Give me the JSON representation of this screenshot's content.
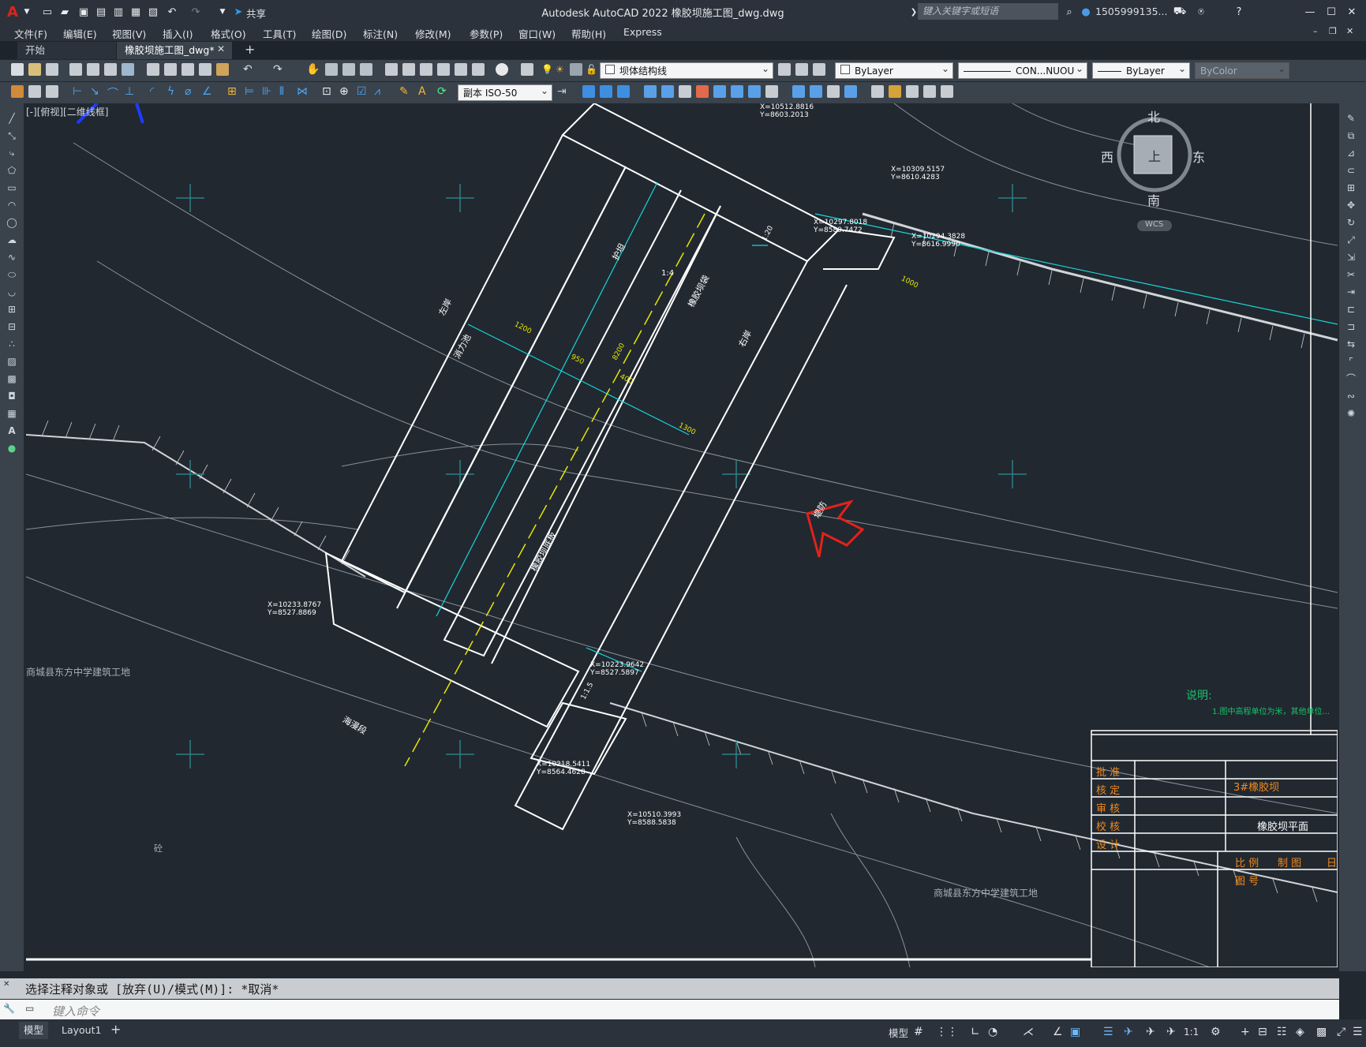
{
  "title_bar": {
    "app_title": "Autodesk AutoCAD 2022    橡胶坝施工图_dwg.dwg",
    "share_label": "共享",
    "search_placeholder": "键入关键字或短语",
    "user": "1505999135..."
  },
  "menu": {
    "items": [
      "文件(F)",
      "编辑(E)",
      "视图(V)",
      "插入(I)",
      "格式(O)",
      "工具(T)",
      "绘图(D)",
      "标注(N)",
      "修改(M)",
      "参数(P)",
      "窗口(W)",
      "帮助(H)",
      "Express"
    ]
  },
  "file_tabs": {
    "start": "开始",
    "active": "橡胶坝施工图_dwg*"
  },
  "toolbar": {
    "layer_name": "坝体结构线",
    "color": "ByLayer",
    "linetype": "CON...NUOU",
    "lineweight": "ByLayer",
    "plotstyle": "ByColor",
    "dimstyle": "副本 ISO-50"
  },
  "viewport": {
    "label": "[-][俯视][二维线框]",
    "viewcube": {
      "n": "北",
      "s": "南",
      "e": "东",
      "w": "西",
      "top": "上",
      "wcs": "WCS"
    }
  },
  "drawing": {
    "site_left": "商城县东方中学建筑工地",
    "site_bottom": "商城县东方中学建筑工地",
    "notes_title": "说明:",
    "notes_line": "1.图中高程单位为米，其他单位...",
    "coords": [
      "X=10512.8816\nY=8603.2013",
      "X=10309.5157\nY=8610.4283",
      "X=10297.8018\nY=8589.7472",
      "X=10294.3828\nY=8616.9990",
      "X=10233.8767\nY=8527.8869",
      "X=10223.9642\nY=8527.5897",
      "X=10218.5411\nY=8564.4628",
      "X=10510.3993\nY=8588.5838"
    ],
    "labels": [
      "消力池",
      "护坦",
      "橡胶坝底板",
      "海漫段",
      "橡胶坝袋",
      "堤防",
      "左岸",
      "右岸",
      "1:4",
      "1:20",
      "1:1.5",
      "1200",
      "950",
      "400",
      "1300",
      "1000",
      "8200"
    ],
    "other_label": "砼"
  },
  "title_block": {
    "rows": [
      "批 准",
      "核 定",
      "审 核",
      "校 核",
      "设 计",
      "比 例",
      "图 号"
    ],
    "project": "3#橡胶坝",
    "drawing_name": "橡胶坝平面",
    "scale_label": "制 图",
    "date_label": "日"
  },
  "command": {
    "history": "选择注释对象或 [放弃(U)/模式(M)]: *取消*",
    "placeholder": "键入命令"
  },
  "status": {
    "tabs": [
      "模型",
      "Layout1"
    ],
    "model_label": "模型",
    "scale": "1:1"
  },
  "colors": {
    "background": "#212830",
    "structure": "#ffffff",
    "cyan": "#19d6d6",
    "yellow": "#e6e600",
    "orange": "#f28a1e",
    "red": "#e2221b"
  }
}
